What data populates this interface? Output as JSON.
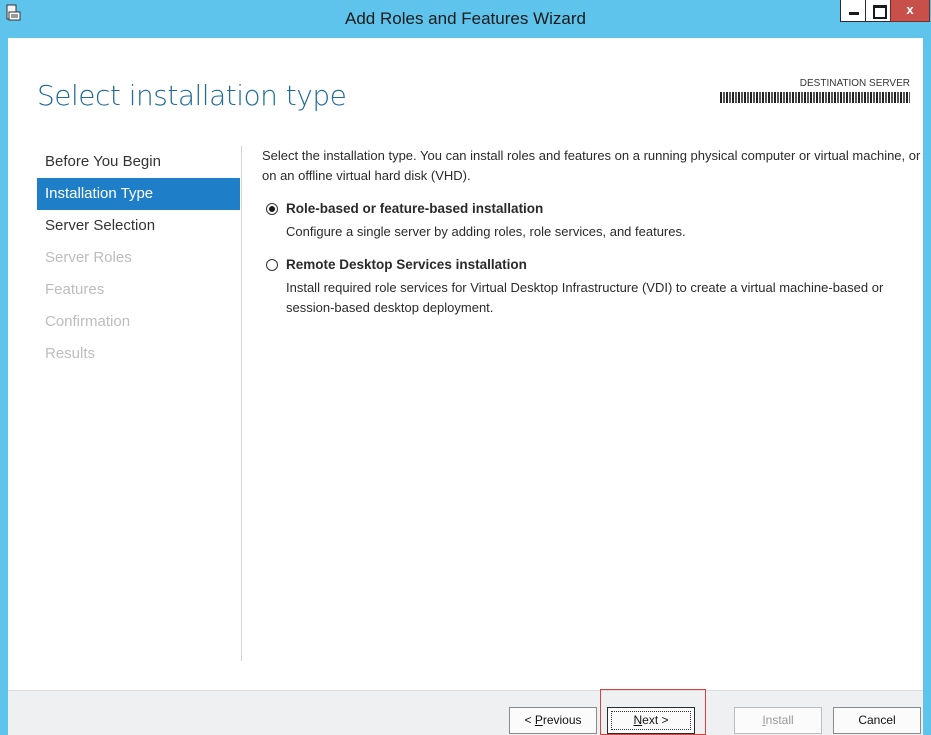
{
  "window": {
    "title": "Add Roles and Features Wizard",
    "close_glyph": "x"
  },
  "header": {
    "heading": "Select installation type",
    "destination_label": "DESTINATION SERVER"
  },
  "nav": {
    "items": [
      {
        "label": "Before You Begin",
        "state": "normal"
      },
      {
        "label": "Installation Type",
        "state": "active"
      },
      {
        "label": "Server Selection",
        "state": "normal"
      },
      {
        "label": "Server Roles",
        "state": "disabled"
      },
      {
        "label": "Features",
        "state": "disabled"
      },
      {
        "label": "Confirmation",
        "state": "disabled"
      },
      {
        "label": "Results",
        "state": "disabled"
      }
    ]
  },
  "content": {
    "intro": "Select the installation type. You can install roles and features on a running physical computer or virtual machine, or on an offline virtual hard disk (VHD).",
    "options": [
      {
        "title": "Role-based or feature-based installation",
        "description": "Configure a single server by adding roles, role services, and features.",
        "selected": true
      },
      {
        "title": "Remote Desktop Services installation",
        "description": "Install required role services for Virtual Desktop Infrastructure (VDI) to create a virtual machine-based or session-based desktop deployment.",
        "selected": false
      }
    ]
  },
  "footer": {
    "previous": {
      "prefix": "< ",
      "mnemonic": "P",
      "rest": "revious"
    },
    "next": {
      "mnemonic": "N",
      "rest": "ext >"
    },
    "install": {
      "mnemonic": "I",
      "rest": "nstall"
    },
    "cancel": "Cancel"
  },
  "colors": {
    "titlebar": "#5ec4ec",
    "nav_active": "#1e7ec8",
    "heading": "#1e6a9a",
    "highlight": "#d94141"
  }
}
